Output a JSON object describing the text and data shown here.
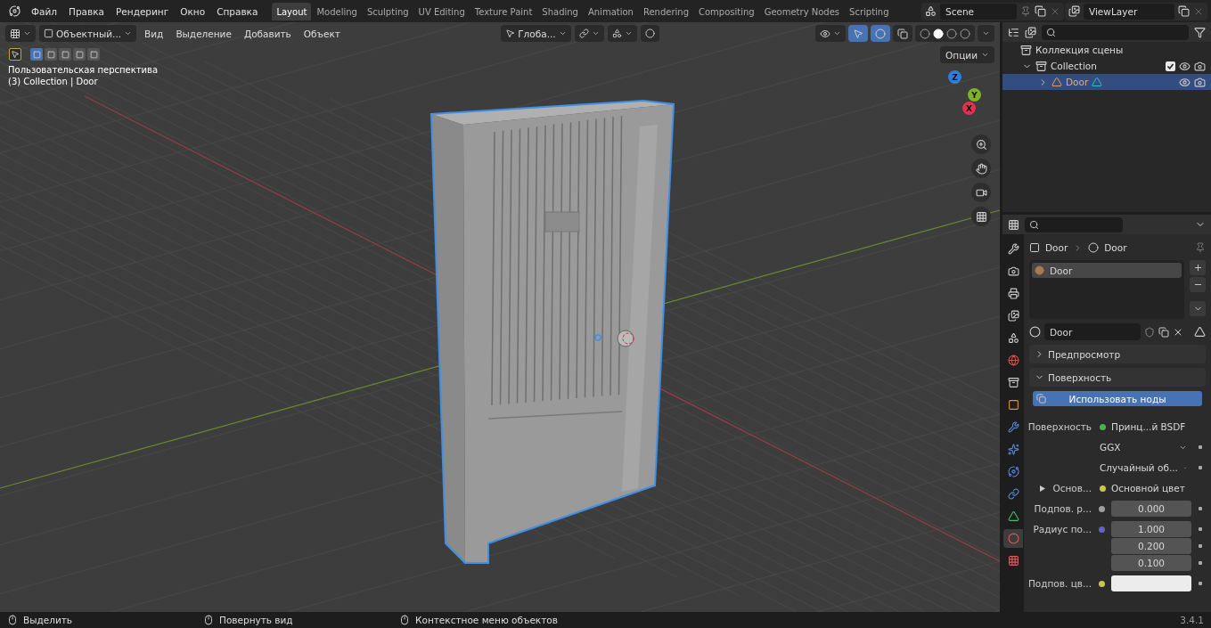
{
  "menu": [
    "Файл",
    "Правка",
    "Рендеринг",
    "Окно",
    "Справка"
  ],
  "workspaces": [
    {
      "label": "Layout",
      "selected": true
    },
    {
      "label": "Modeling",
      "selected": false
    },
    {
      "label": "Sculpting",
      "selected": false
    },
    {
      "label": "UV Editing",
      "selected": false
    },
    {
      "label": "Texture Paint",
      "selected": false
    },
    {
      "label": "Shading",
      "selected": false
    },
    {
      "label": "Animation",
      "selected": false
    },
    {
      "label": "Rendering",
      "selected": false
    },
    {
      "label": "Compositing",
      "selected": false
    },
    {
      "label": "Geometry Nodes",
      "selected": false
    },
    {
      "label": "Scripting",
      "selected": false
    }
  ],
  "scene": "Scene",
  "view_layer": "ViewLayer",
  "viewport": {
    "mode": "Объектный...",
    "menus": [
      "Вид",
      "Выделение",
      "Добавить",
      "Объект"
    ],
    "orientation": "Глоба...",
    "options": "Опции",
    "select_modes": [
      {
        "selected": true
      },
      {
        "selected": false
      },
      {
        "selected": false
      },
      {
        "selected": false
      },
      {
        "selected": false
      }
    ],
    "toggles": [
      {
        "kind": "gizmo",
        "on": true
      },
      {
        "kind": "overlay",
        "on": true
      },
      {
        "kind": "xray",
        "on": false
      }
    ],
    "shading": [
      {
        "selected": false
      },
      {
        "selected": true
      },
      {
        "selected": false
      },
      {
        "selected": false
      }
    ],
    "view_name": "Пользовательская перспектива",
    "object_info": "(3) Collection | Door",
    "gizmo_axes": [
      {
        "label": "Z",
        "color": "#2f7fd8"
      },
      {
        "label": "Y",
        "color": "#7db22a"
      },
      {
        "label": "X",
        "color": "#e0314f"
      }
    ]
  },
  "outliner": {
    "root": "Коллекция сцены",
    "items": [
      {
        "label": "Collection",
        "kind": "collection",
        "expanded": true,
        "checked": true,
        "selected": false,
        "children": [
          {
            "label": "Door",
            "kind": "object",
            "expanded": false,
            "selected": true
          }
        ]
      }
    ]
  },
  "properties": {
    "tabs": [
      {
        "kind": "tool",
        "selected": false
      },
      {
        "kind": "render",
        "selected": false
      },
      {
        "kind": "output",
        "selected": false
      },
      {
        "kind": "view_layer",
        "selected": false
      },
      {
        "kind": "scene",
        "selected": false
      },
      {
        "kind": "world",
        "selected": false
      },
      {
        "kind": "collection",
        "selected": false
      },
      {
        "kind": "object",
        "selected": false
      },
      {
        "kind": "modifiers",
        "selected": false
      },
      {
        "kind": "particles",
        "selected": false
      },
      {
        "kind": "physics",
        "selected": false
      },
      {
        "kind": "constraints",
        "selected": false
      },
      {
        "kind": "data",
        "selected": false
      },
      {
        "kind": "material",
        "selected": true
      },
      {
        "kind": "texture",
        "selected": false
      }
    ],
    "breadcrumb": [
      "Door",
      "Door"
    ],
    "slots": [
      {
        "name": "Door",
        "selected": true
      }
    ],
    "material": "Door",
    "panels": [
      {
        "title": "Предпросмотр",
        "expanded": false
      },
      {
        "title": "Поверхность",
        "expanded": true
      }
    ],
    "use_nodes": "Использовать ноды",
    "rows": [
      {
        "kind": "link",
        "label": "Поверхность",
        "value": "Принц...й BSDF",
        "color": "#4caf50"
      },
      {
        "kind": "dropdown",
        "value": "GGX"
      },
      {
        "kind": "dropdown",
        "value": "Случайный об..."
      },
      {
        "kind": "link",
        "label": "Основ...",
        "value": "Основной цвет",
        "color": "#c7c74a",
        "expandable": true
      },
      {
        "kind": "number",
        "label": "Подпов. р...",
        "color": "#a0a0a0",
        "values": [
          "0.000"
        ]
      },
      {
        "kind": "number",
        "label": "Радиус по...",
        "color": "#6363c7",
        "values": [
          "1.000",
          "0.200",
          "0.100"
        ]
      },
      {
        "kind": "swatch",
        "label": "Подпов. цв...",
        "color": "#c7c74a"
      }
    ]
  },
  "status": [
    "Выделить",
    "Повернуть вид",
    "Контекстное меню объектов"
  ],
  "version": "3.4.1"
}
